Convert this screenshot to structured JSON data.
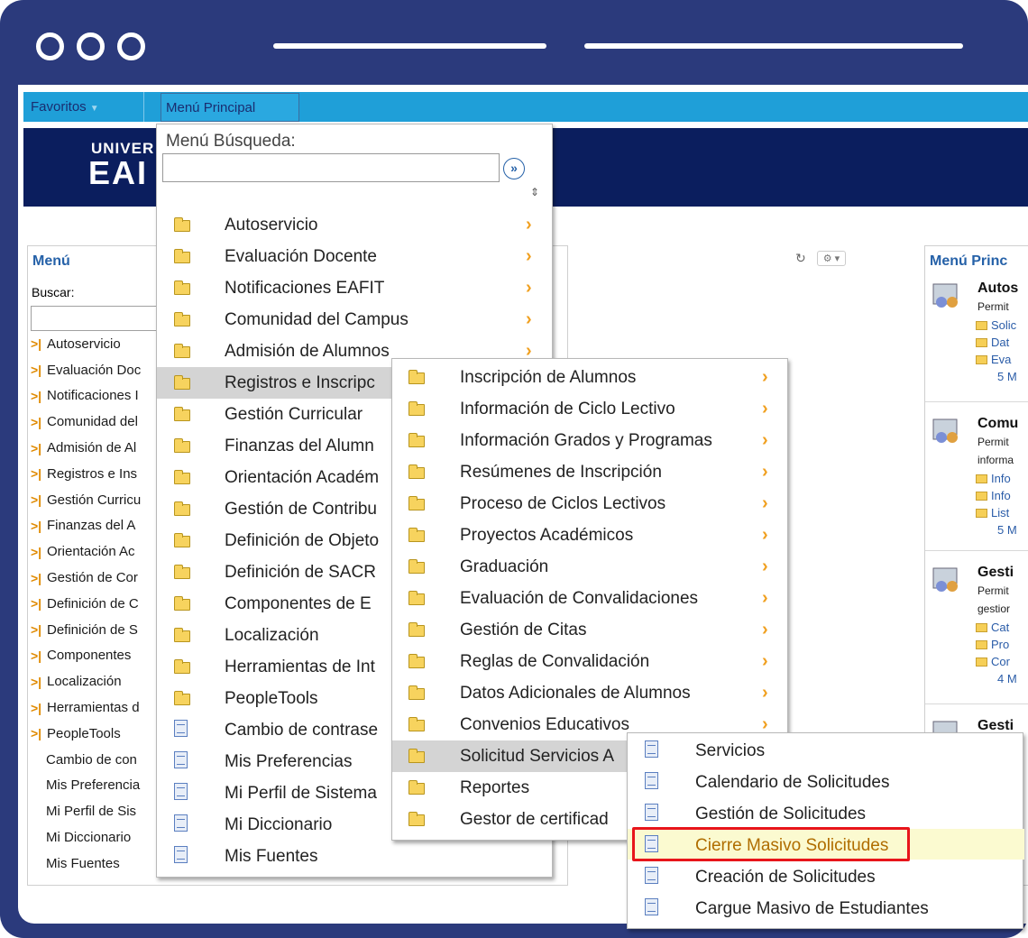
{
  "nav": {
    "favoritos": "Favoritos",
    "menu_principal": "Menú Principal"
  },
  "banner": {
    "logo_line1": "UNIVER",
    "logo_line2": "EAI"
  },
  "menu_panel": {
    "title": "Menú",
    "search_label": "Buscar:",
    "items": [
      {
        "label": "Autoservicio",
        "folder": true
      },
      {
        "label": "Evaluación Doc",
        "folder": true
      },
      {
        "label": "Notificaciones I",
        "folder": true
      },
      {
        "label": "Comunidad del",
        "folder": true
      },
      {
        "label": "Admisión de Al",
        "folder": true
      },
      {
        "label": "Registros e Ins",
        "folder": true
      },
      {
        "label": "Gestión Curricu",
        "folder": true
      },
      {
        "label": "Finanzas del A",
        "folder": true
      },
      {
        "label": "Orientación Ac",
        "folder": true
      },
      {
        "label": "Gestión de Cor",
        "folder": true
      },
      {
        "label": "Definición de C",
        "folder": true
      },
      {
        "label": "Definición de S",
        "folder": true
      },
      {
        "label": "Componentes",
        "folder": true
      },
      {
        "label": "Localización",
        "folder": true
      },
      {
        "label": "Herramientas d",
        "folder": true
      },
      {
        "label": "PeopleTools",
        "folder": true
      },
      {
        "label": "Cambio de con",
        "folder": false
      },
      {
        "label": "Mis Preferencia",
        "folder": false
      },
      {
        "label": "Mi Perfil de Sis",
        "folder": false
      },
      {
        "label": "Mi Diccionario",
        "folder": false
      },
      {
        "label": "Mis Fuentes",
        "folder": false
      }
    ]
  },
  "right_panel": {
    "title": "Menú Princ",
    "sections": [
      {
        "head": "Autos",
        "desc": [
          "Permit"
        ],
        "links": [
          "Solic",
          "Dat",
          "Eva"
        ],
        "more": "5 M"
      },
      {
        "head": "Comu",
        "desc": [
          "Permit",
          "informa"
        ],
        "links": [
          "Info",
          "Info",
          "List"
        ],
        "more": "5 M"
      },
      {
        "head": "Gesti",
        "desc": [
          "Permit",
          "gestior"
        ],
        "links": [
          "Cat",
          "Pro",
          "Cor"
        ],
        "more": "4 M"
      },
      {
        "head": "Gesti",
        "desc": [],
        "links": [],
        "more": ""
      }
    ]
  },
  "dropdown1": {
    "title": "Menú Búsqueda:",
    "items": [
      {
        "label": "Autoservicio",
        "folder": true,
        "submenu": true
      },
      {
        "label": "Evaluación Docente",
        "folder": true,
        "submenu": true
      },
      {
        "label": "Notificaciones EAFIT",
        "folder": true,
        "submenu": true
      },
      {
        "label": "Comunidad del Campus",
        "folder": true,
        "submenu": true
      },
      {
        "label": "Admisión de Alumnos",
        "folder": true,
        "submenu": true
      },
      {
        "label": "Registros e Inscripc",
        "folder": true,
        "submenu": true,
        "highlighted": true
      },
      {
        "label": "Gestión Curricular",
        "folder": true,
        "submenu": false
      },
      {
        "label": "Finanzas del Alumn",
        "folder": true,
        "submenu": false
      },
      {
        "label": "Orientación Académ",
        "folder": true,
        "submenu": false
      },
      {
        "label": "Gestión de Contribu",
        "folder": true,
        "submenu": false
      },
      {
        "label": "Definición de Objeto",
        "folder": true,
        "submenu": false
      },
      {
        "label": "Definición de SACR",
        "folder": true,
        "submenu": false
      },
      {
        "label": "Componentes de E",
        "folder": true,
        "submenu": false
      },
      {
        "label": "Localización",
        "folder": true,
        "submenu": false
      },
      {
        "label": "Herramientas de Int",
        "folder": true,
        "submenu": false
      },
      {
        "label": "PeopleTools",
        "folder": true,
        "submenu": false
      },
      {
        "label": "Cambio de contrase",
        "folder": false,
        "submenu": false
      },
      {
        "label": "Mis Preferencias",
        "folder": false,
        "submenu": false
      },
      {
        "label": "Mi Perfil de Sistema",
        "folder": false,
        "submenu": false
      },
      {
        "label": "Mi Diccionario",
        "folder": false,
        "submenu": false
      },
      {
        "label": "Mis Fuentes",
        "folder": false,
        "submenu": false
      }
    ]
  },
  "dropdown2": {
    "items": [
      {
        "label": "Inscripción de Alumnos",
        "submenu": true
      },
      {
        "label": "Información de Ciclo Lectivo",
        "submenu": true
      },
      {
        "label": "Información Grados y Programas",
        "submenu": true
      },
      {
        "label": "Resúmenes de Inscripción",
        "submenu": true
      },
      {
        "label": "Proceso de Ciclos Lectivos",
        "submenu": true
      },
      {
        "label": "Proyectos Académicos",
        "submenu": true
      },
      {
        "label": "Graduación",
        "submenu": true
      },
      {
        "label": "Evaluación de Convalidaciones",
        "submenu": true
      },
      {
        "label": "Gestión de Citas",
        "submenu": true
      },
      {
        "label": "Reglas de Convalidación",
        "submenu": true
      },
      {
        "label": "Datos Adicionales de Alumnos",
        "submenu": true
      },
      {
        "label": "Convenios Educativos",
        "submenu": true
      },
      {
        "label": "Solicitud Servicios A",
        "submenu": false,
        "highlighted": true
      },
      {
        "label": "Reportes",
        "submenu": false
      },
      {
        "label": "Gestor de certificad",
        "submenu": false
      }
    ]
  },
  "dropdown3": {
    "items": [
      {
        "label": "Servicios"
      },
      {
        "label": "Calendario de Solicitudes"
      },
      {
        "label": "Gestión de Solicitudes"
      },
      {
        "label": "Cierre Masivo Solicitudes",
        "selected": true
      },
      {
        "label": "Creación de Solicitudes"
      },
      {
        "label": "Cargue Masivo de Estudiantes"
      }
    ]
  },
  "colors": {
    "frame": "#2b3a7c",
    "nav_bar": "#1f9fd8",
    "banner": "#0b1e5e",
    "highlight_box": "#e8151b"
  }
}
